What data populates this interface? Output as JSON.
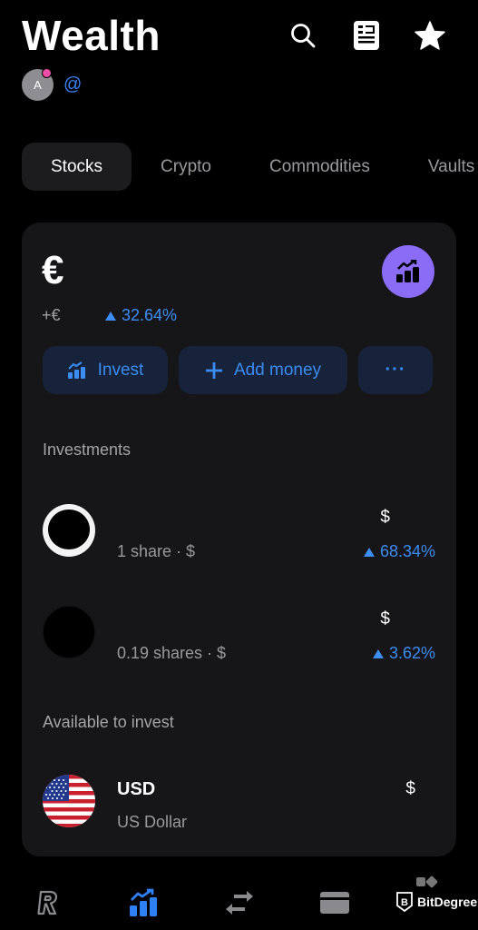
{
  "header": {
    "title": "Wealth",
    "avatar_initial": "A",
    "handle": "@",
    "icons": [
      "search-icon",
      "news-icon",
      "star-icon"
    ]
  },
  "tabs": [
    {
      "label": "Stocks",
      "active": true
    },
    {
      "label": "Crypto",
      "active": false
    },
    {
      "label": "Commodities",
      "active": false
    },
    {
      "label": "Vaults",
      "active": false
    }
  ],
  "balance": {
    "currency_symbol": "€",
    "change_amount": "+€",
    "change_percent": "32.64%",
    "chart_button_icon": "growth-chart-icon"
  },
  "actions": {
    "invest_label": "Invest",
    "add_money_label": "Add money",
    "more_label": "···"
  },
  "investments": {
    "heading": "Investments",
    "items": [
      {
        "value": "$",
        "subtitle": "1 share · $",
        "change_percent": "68.34%"
      },
      {
        "value": "$",
        "subtitle": "0.19 shares · $",
        "change_percent": "3.62%"
      }
    ]
  },
  "available": {
    "heading": "Available to invest",
    "items": [
      {
        "code": "USD",
        "name": "US Dollar",
        "value": "$"
      }
    ]
  },
  "bottom_nav": {
    "items": [
      "home-icon",
      "invest-icon",
      "transfer-icon",
      "cards-icon"
    ],
    "active": "invest-icon"
  },
  "watermark": {
    "text": "BitDegree"
  },
  "colors": {
    "accent_blue": "#3d8df5",
    "purple": "#8b6cf7",
    "card_bg": "#161618",
    "notification_pink": "#ee4ea6"
  }
}
